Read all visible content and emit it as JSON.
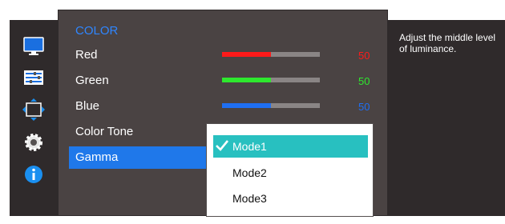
{
  "sidebar": {
    "items": [
      {
        "icon": "picture-monitor-icon"
      },
      {
        "icon": "color-sliders-icon"
      },
      {
        "icon": "size-position-icon"
      },
      {
        "icon": "settings-gear-icon"
      },
      {
        "icon": "information-icon"
      }
    ]
  },
  "menu": {
    "title": "COLOR",
    "items": [
      {
        "label": "Red",
        "value": "50",
        "level": 0.5,
        "color": "#ff1a1a"
      },
      {
        "label": "Green",
        "value": "50",
        "level": 0.5,
        "color": "#2ee82e"
      },
      {
        "label": "Blue",
        "value": "50",
        "level": 0.5,
        "color": "#1f6ff2"
      },
      {
        "label": "Color Tone"
      },
      {
        "label": "Gamma",
        "selected": true
      }
    ]
  },
  "dropdown": {
    "options": [
      {
        "label": "Mode1",
        "selected": true
      },
      {
        "label": "Mode2",
        "selected": false
      },
      {
        "label": "Mode3",
        "selected": false
      }
    ]
  },
  "help": {
    "text": "Adjust the middle level of luminance."
  },
  "colors": {
    "accent": "#1f78ea",
    "highlight": "#28c0c0",
    "panel": "#4a4343",
    "rail": "#2f2a2b"
  }
}
